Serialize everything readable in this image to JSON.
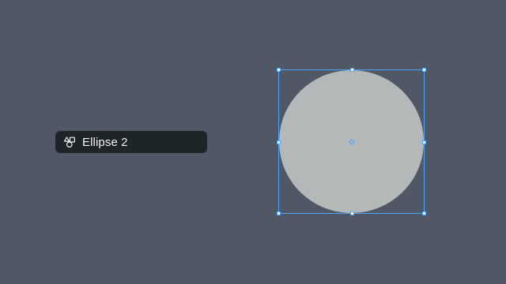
{
  "layer": {
    "name": "Ellipse 2",
    "icon": "shapes-icon"
  },
  "colors": {
    "canvas": "#4f5864",
    "ellipse_fill": "#b5b8b9",
    "selection": "#4aa3ff",
    "pill": "#1e2529",
    "pill_text": "#f1f3f5"
  }
}
